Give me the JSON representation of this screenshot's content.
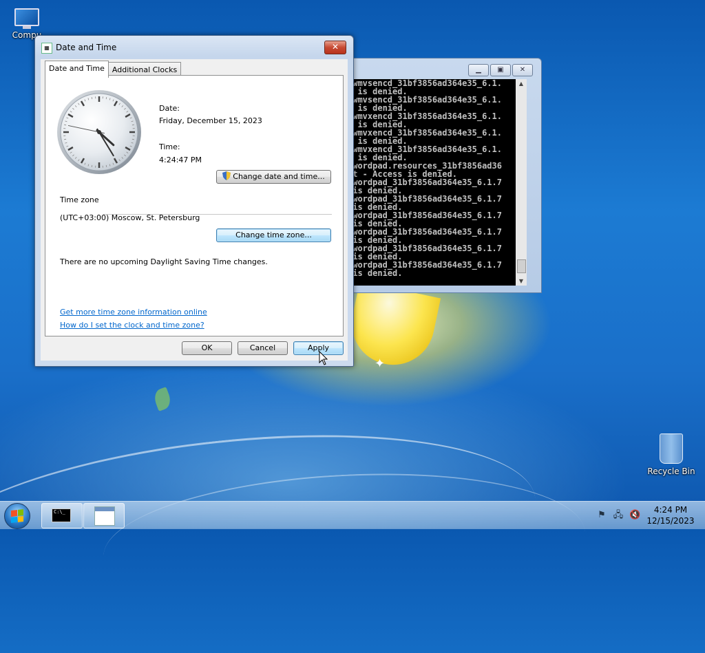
{
  "desktop": {
    "icons": {
      "computer": "Compu",
      "recycle_bin": "Recycle Bin"
    }
  },
  "console": {
    "lines": [
      "-wmvsencd_31bf3856ad364e35_6.1.",
      "s is denied.",
      "-wmvsencd_31bf3856ad364e35_6.1.",
      "s is denied.",
      "-wmvxencd_31bf3856ad364e35_6.1.",
      "s is denied.",
      "-wmvxencd_31bf3856ad364e35_6.1.",
      "s is denied.",
      "-wmvxencd_31bf3856ad364e35_6.1.",
      "s is denied.",
      "-wordpad.resources_31bf3856ad36",
      "st - Access is denied.",
      "-wordpad_31bf3856ad364e35_6.1.7",
      " is denied.",
      "-wordpad_31bf3856ad364e35_6.1.7",
      " is denied.",
      "-wordpad_31bf3856ad364e35_6.1.7",
      " is denied.",
      "-wordpad_31bf3856ad364e35_6.1.7",
      " is denied.",
      "-wordpad_31bf3856ad364e35_6.1.7",
      " is denied.",
      "-wordpad_31bf3856ad364e35_6.1.7",
      " is denied."
    ]
  },
  "dialog": {
    "title": "Date and Time",
    "tabs": [
      {
        "label": "Date and Time"
      },
      {
        "label": "Additional Clocks"
      }
    ],
    "clock": {
      "hours": 4,
      "minutes": 24,
      "seconds": 47
    },
    "date_label": "Date:",
    "date_value": "Friday, December 15, 2023",
    "time_label": "Time:",
    "time_value": "4:24:47 PM",
    "change_datetime_button": "Change date and time...",
    "timezone_heading": "Time zone",
    "timezone_value": "(UTC+03:00) Moscow, St. Petersburg",
    "change_timezone_button": "Change time zone...",
    "dst_message": "There are no upcoming Daylight Saving Time changes.",
    "link_more_info": "Get more time zone information online",
    "link_how_to": "How do I set the clock and time zone?",
    "ok_button": "OK",
    "cancel_button": "Cancel",
    "apply_button": "Apply"
  },
  "taskbar": {
    "time": "4:24 PM",
    "date": "12/15/2023",
    "tray_icons": [
      "action-center-flag-icon",
      "network-icon",
      "volume-muted-icon"
    ]
  },
  "colors": {
    "link": "#0066cc",
    "close_button": "#c74a33"
  }
}
